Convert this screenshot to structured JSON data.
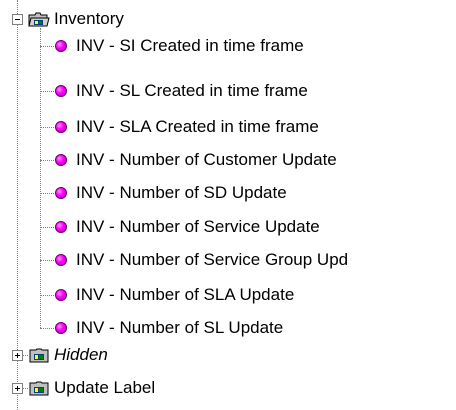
{
  "tree": {
    "root": {
      "label": "Inventory",
      "expanded": true,
      "icon": "folder-open-icon",
      "children": [
        "INV - SI Created in time frame",
        "INV - SL Created in time frame",
        "INV - SLA Created in time frame",
        "INV - Number of Customer Update",
        "INV - Number of SD Update",
        "INV - Number of Service Update",
        "INV - Number of Service Group Upd",
        "INV - Number of SLA Update",
        "INV - Number of SL Update"
      ],
      "child_icon": "magenta-bullet-icon",
      "child_color": "#ff00ff"
    },
    "siblings": [
      {
        "label": "Hidden",
        "expanded": false,
        "icon": "folder-icon",
        "italic": true
      },
      {
        "label": "Update Label",
        "expanded": false,
        "icon": "folder-icon",
        "italic": false
      }
    ]
  }
}
